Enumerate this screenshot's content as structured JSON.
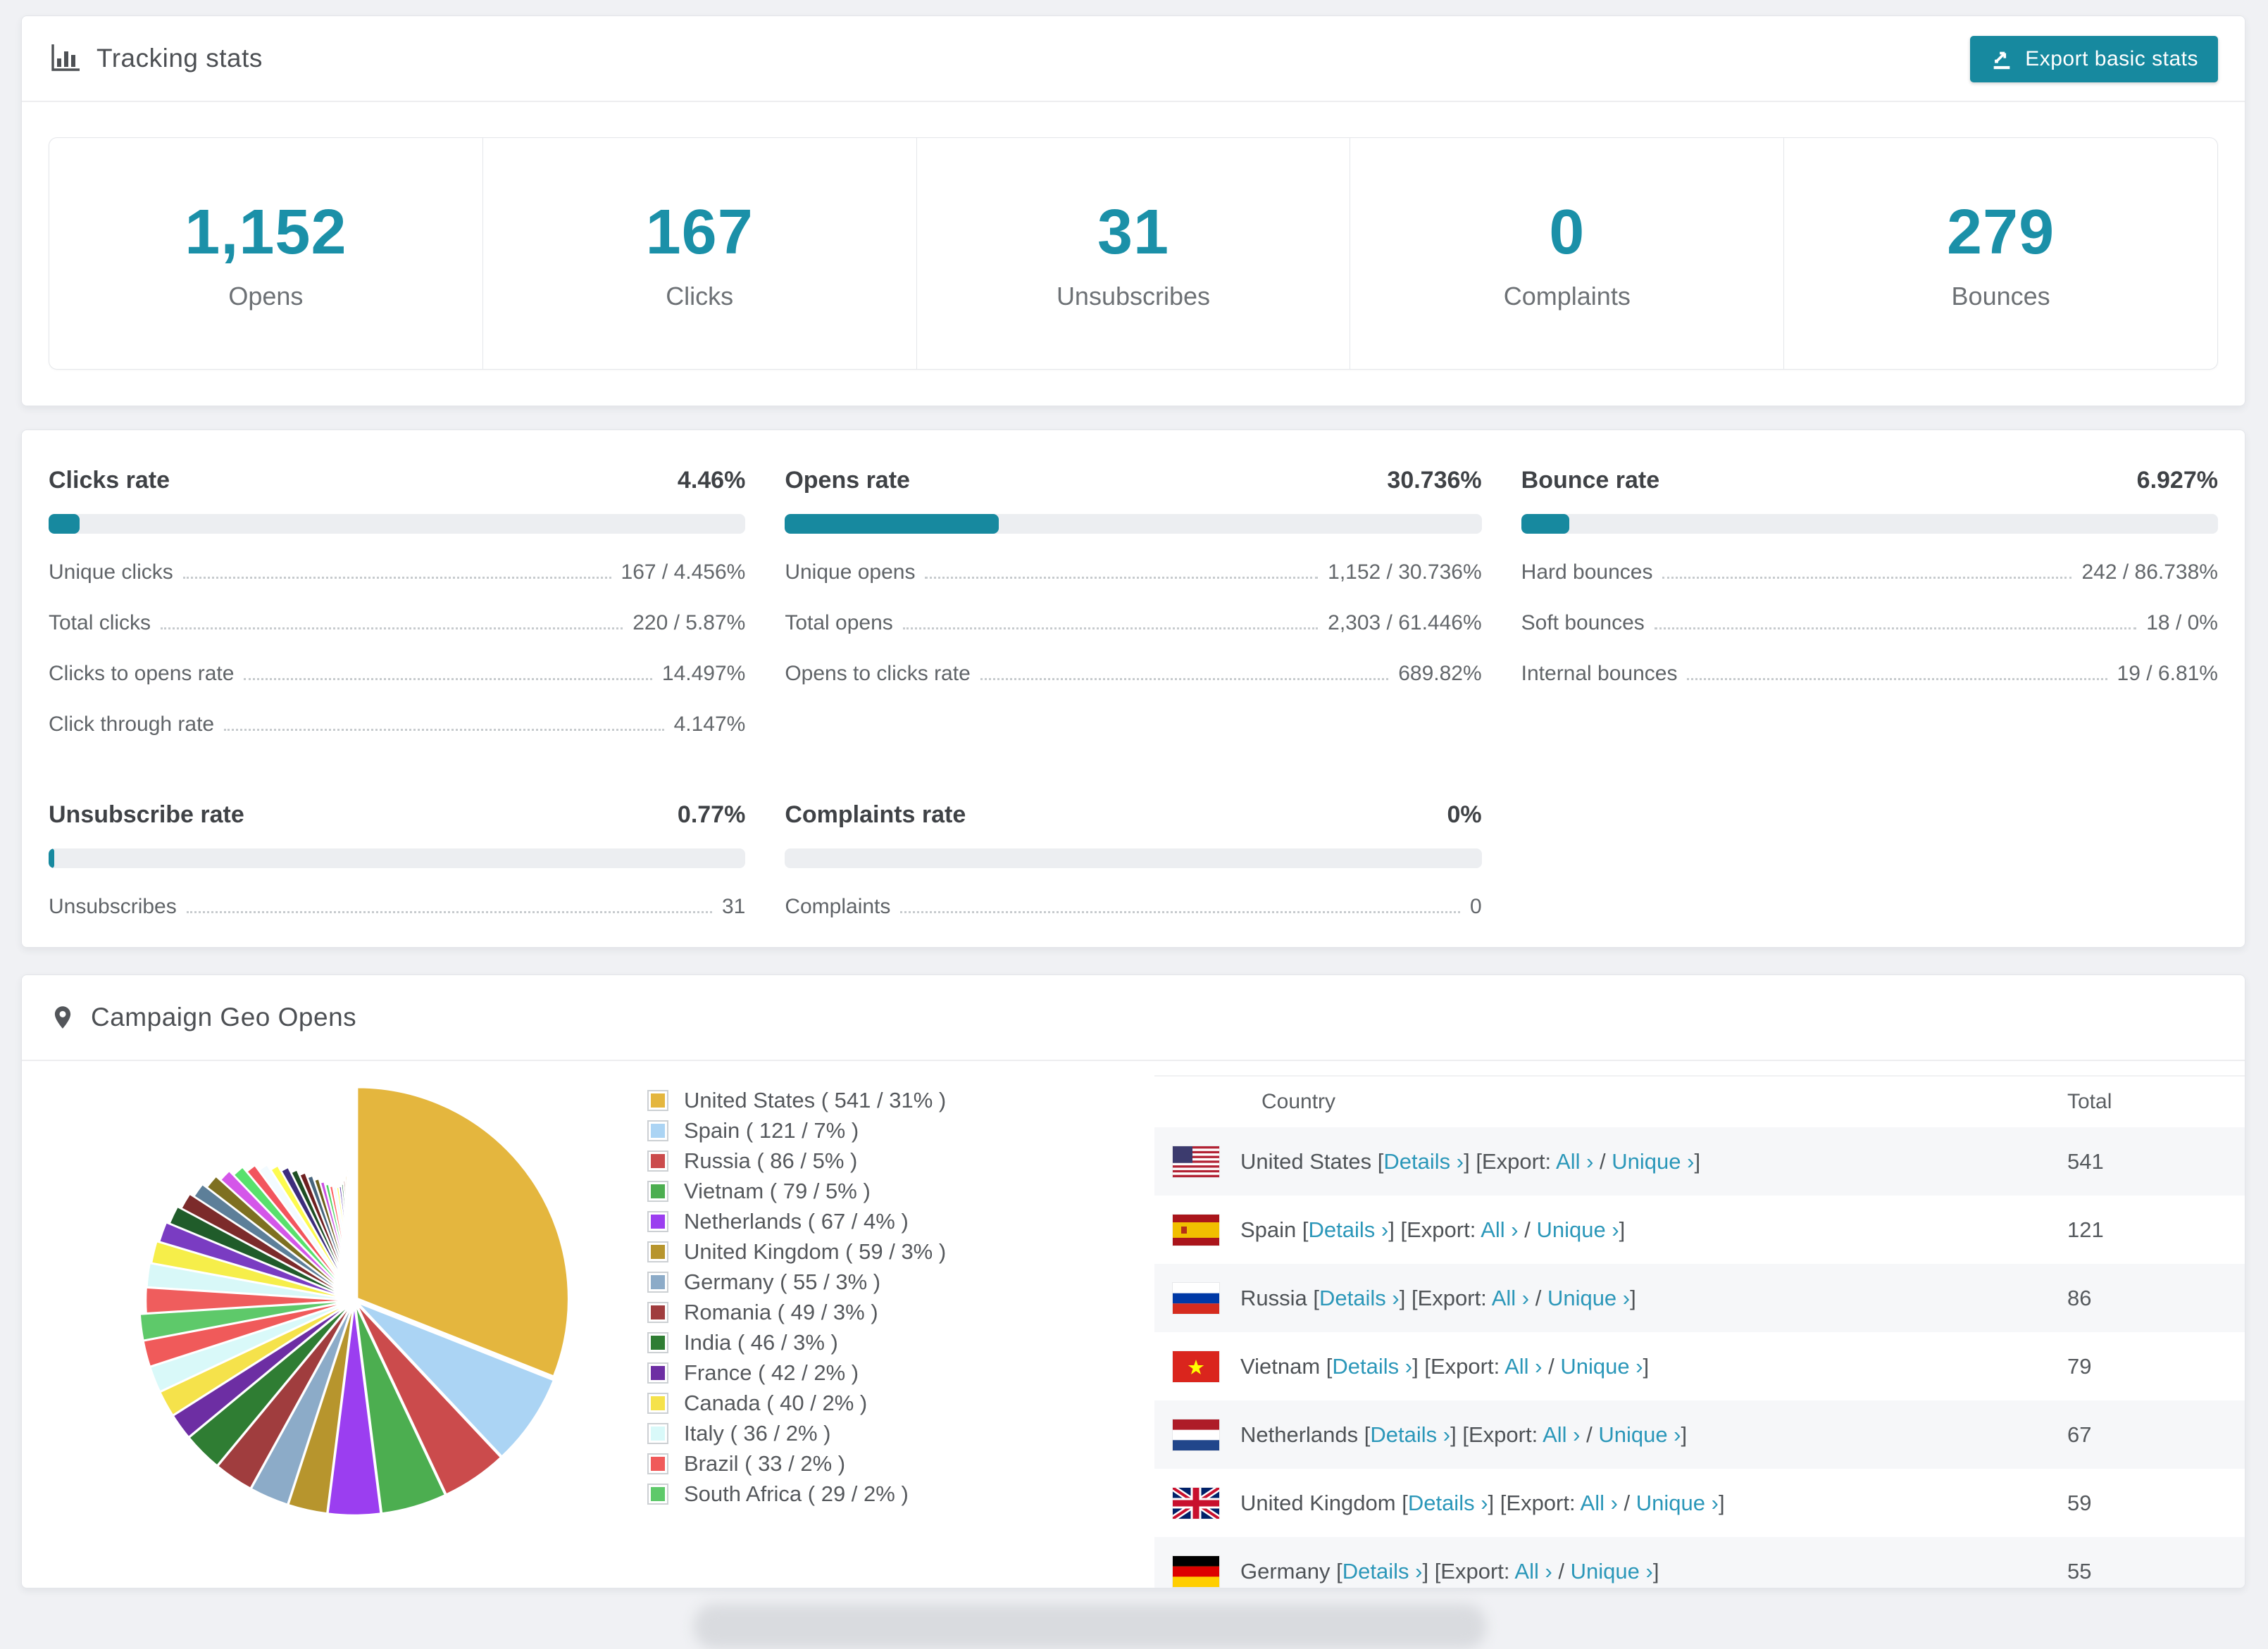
{
  "colors": {
    "accent_teal": "#17899f",
    "number_teal": "#1b90a8",
    "link_teal": "#2b97b9",
    "track_gray": "#eceef1",
    "page_bg": "#f0f1f4"
  },
  "tracking_stats": {
    "title": "Tracking stats",
    "export_button": {
      "label": "Export basic stats"
    },
    "cards": [
      {
        "value": "1,152",
        "label": "Opens"
      },
      {
        "value": "167",
        "label": "Clicks"
      },
      {
        "value": "31",
        "label": "Unsubscribes"
      },
      {
        "value": "0",
        "label": "Complaints"
      },
      {
        "value": "279",
        "label": "Bounces"
      }
    ]
  },
  "rates": [
    {
      "id": "clicks",
      "title": "Clicks rate",
      "value": "4.46%",
      "bar_pct": 4.46,
      "rows": [
        {
          "label": "Unique clicks",
          "value": "167 / 4.456%"
        },
        {
          "label": "Total clicks",
          "value": "220 / 5.87%"
        },
        {
          "label": "Clicks to opens rate",
          "value": "14.497%"
        },
        {
          "label": "Click through rate",
          "value": "4.147%"
        }
      ]
    },
    {
      "id": "opens",
      "title": "Opens rate",
      "value": "30.736%",
      "bar_pct": 30.736,
      "rows": [
        {
          "label": "Unique opens",
          "value": "1,152 / 30.736%"
        },
        {
          "label": "Total opens",
          "value": "2,303 / 61.446%"
        },
        {
          "label": "Opens to clicks rate",
          "value": "689.82%"
        }
      ]
    },
    {
      "id": "bounce",
      "title": "Bounce rate",
      "value": "6.927%",
      "bar_pct": 6.927,
      "rows": [
        {
          "label": "Hard bounces",
          "value": "242 / 86.738%"
        },
        {
          "label": "Soft bounces",
          "value": "18 / 0%"
        },
        {
          "label": "Internal bounces",
          "value": "19 / 6.81%"
        }
      ]
    },
    {
      "id": "unsubscribe",
      "title": "Unsubscribe rate",
      "value": "0.77%",
      "bar_pct": 0.77,
      "rows": [
        {
          "label": "Unsubscribes",
          "value": "31"
        }
      ]
    },
    {
      "id": "complaints",
      "title": "Complaints rate",
      "value": "0%",
      "bar_pct": 0,
      "rows": [
        {
          "label": "Complaints",
          "value": "0"
        }
      ]
    }
  ],
  "geo": {
    "title": "Campaign Geo Opens",
    "table": {
      "headers": {
        "country": "Country",
        "total": "Total"
      },
      "link_labels": {
        "details": "Details ›",
        "export_prefix": "Export:",
        "all": "All ›",
        "unique": "Unique ›"
      },
      "rows": [
        {
          "country": "United States",
          "flag": "us",
          "total": "541"
        },
        {
          "country": "Spain",
          "flag": "es",
          "total": "121"
        },
        {
          "country": "Russia",
          "flag": "ru",
          "total": "86"
        },
        {
          "country": "Vietnam",
          "flag": "vn",
          "total": "79"
        },
        {
          "country": "Netherlands",
          "flag": "nl",
          "total": "67"
        },
        {
          "country": "United Kingdom",
          "flag": "gb",
          "total": "59"
        },
        {
          "country": "Germany",
          "flag": "de",
          "total": "55"
        }
      ]
    }
  },
  "chart_data": {
    "type": "pie",
    "title": "Campaign Geo Opens",
    "legend_position": "right",
    "start_angle_deg": -90,
    "direction": "clockwise",
    "series": [
      {
        "name": "United States",
        "value": 541,
        "pct": 31,
        "color": "#e4b63e"
      },
      {
        "name": "Spain",
        "value": 121,
        "pct": 7,
        "color": "#abd4f4"
      },
      {
        "name": "Russia",
        "value": 86,
        "pct": 5,
        "color": "#cb4b4c"
      },
      {
        "name": "Vietnam",
        "value": 79,
        "pct": 5,
        "color": "#4cae50"
      },
      {
        "name": "Netherlands",
        "value": 67,
        "pct": 4,
        "color": "#9b3ef0"
      },
      {
        "name": "United Kingdom",
        "value": 59,
        "pct": 3,
        "color": "#b7952d"
      },
      {
        "name": "Germany",
        "value": 55,
        "pct": 3,
        "color": "#8cabc8"
      },
      {
        "name": "Romania",
        "value": 49,
        "pct": 3,
        "color": "#a03d3e"
      },
      {
        "name": "India",
        "value": 46,
        "pct": 3,
        "color": "#2f7d33"
      },
      {
        "name": "France",
        "value": 42,
        "pct": 2,
        "color": "#6d2ea3"
      },
      {
        "name": "Canada",
        "value": 40,
        "pct": 2,
        "color": "#f5e24b"
      },
      {
        "name": "Italy",
        "value": 36,
        "pct": 2,
        "color": "#d9f9f9"
      },
      {
        "name": "Brazil",
        "value": 33,
        "pct": 2,
        "color": "#f05a5a"
      },
      {
        "name": "South Africa",
        "value": 29,
        "pct": 2,
        "color": "#5ec96a"
      }
    ],
    "others_tail": {
      "total_pct": 26,
      "weights": [
        1.6,
        1.5,
        1.4,
        1.3,
        1.2,
        1.1,
        1.0,
        1.0,
        0.9,
        0.9,
        0.8,
        0.8,
        0.7,
        0.7,
        0.6,
        0.6,
        0.55,
        0.5,
        0.45,
        0.4,
        0.38,
        0.35,
        0.3,
        0.28,
        0.25,
        0.22,
        0.2,
        0.18,
        0.15,
        0.13,
        0.1,
        0.08,
        0.06,
        0.05
      ],
      "colors": [
        "#ef5d5d",
        "#d8f8f8",
        "#f6ee4a",
        "#7a3cc2",
        "#205c2a",
        "#7c2b2b",
        "#5d7f99",
        "#7e7021",
        "#d457e9",
        "#58e16d",
        "#f2555d",
        "#f3fbff",
        "#fdfb4f",
        "#3d2d7c",
        "#1d4e23",
        "#6e2020",
        "#47657d",
        "#6c5e1b",
        "#ca50e1",
        "#4dd560",
        "#ff6060",
        "#eefcff",
        "#ffff55",
        "#5633a8",
        "#2a6e33",
        "#8a2626",
        "#d8ab32",
        "#a8d2f0",
        "#d94444",
        "#46b54c",
        "#8b3fe0",
        "#b5952e",
        "#e35050",
        "#7a45d6"
      ]
    },
    "legend_format": "{name} ( {value} / {pct}% )"
  }
}
